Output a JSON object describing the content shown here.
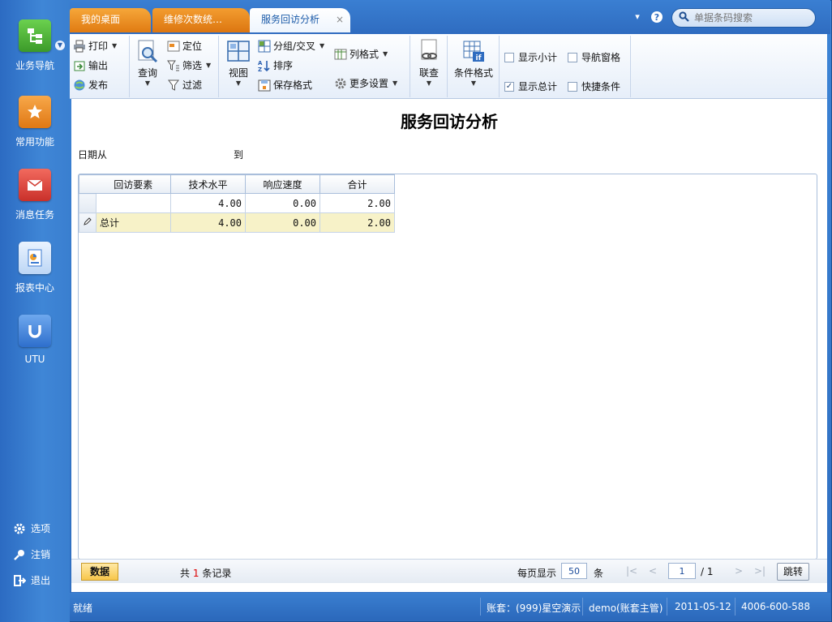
{
  "sidebar": {
    "items": [
      {
        "label": "业务导航",
        "color": "#4fb33c"
      },
      {
        "label": "常用功能",
        "color": "#f28d25"
      },
      {
        "label": "消息任务",
        "color": "#e2463b"
      },
      {
        "label": "报表中心",
        "color": "#4a8fe0"
      },
      {
        "label": "UTU",
        "color": "#2f74d4"
      }
    ],
    "bottom": [
      {
        "label": "选项",
        "icon": "gear-icon"
      },
      {
        "label": "注销",
        "icon": "key-icon"
      },
      {
        "label": "退出",
        "icon": "exit-icon"
      }
    ]
  },
  "tabs": [
    {
      "label": "我的桌面"
    },
    {
      "label": "维修次数统…"
    },
    {
      "label": "服务回访分析",
      "close": "×"
    }
  ],
  "search": {
    "placeholder": "单据条码搜索"
  },
  "ribbon": {
    "print": "打印",
    "export": "输出",
    "publish": "发布",
    "query": "查询",
    "locate": "定位",
    "filter_select": "筛选",
    "filter": "过滤",
    "view": "视图",
    "group_cross": "分组/交叉",
    "sort": "排序",
    "save_format": "保存格式",
    "column_format": "列格式",
    "more_settings": "更多设置",
    "link_query": "联查",
    "condition_format": "条件格式",
    "show_subtotal": "显示小计",
    "nav_pane": "导航窗格",
    "show_total": "显示总计",
    "quick_condition": "快捷条件"
  },
  "report": {
    "title": "服务回访分析",
    "date_from": "日期从",
    "date_to": "到",
    "columns": [
      "回访要素",
      "技术水平",
      "响应速度",
      "合计"
    ],
    "rows": [
      {
        "factor": "",
        "tech": "4.00",
        "speed": "0.00",
        "total": "2.00"
      }
    ],
    "total_row": {
      "factor": "总计",
      "tech": "4.00",
      "speed": "0.00",
      "total": "2.00"
    }
  },
  "pager": {
    "data_button": "数据",
    "record_prefix": "共",
    "record_count": "1",
    "record_suffix": "条记录",
    "per_page_label": "每页显示",
    "per_page": "50",
    "per_page_unit": "条",
    "page": "1",
    "page_total": "/ 1",
    "jump": "跳转"
  },
  "status": {
    "state": "就绪",
    "account": "账套：(999)星空演示",
    "user": "demo(账套主管)",
    "date": "2011-05-12",
    "phone": "4006-600-588"
  }
}
